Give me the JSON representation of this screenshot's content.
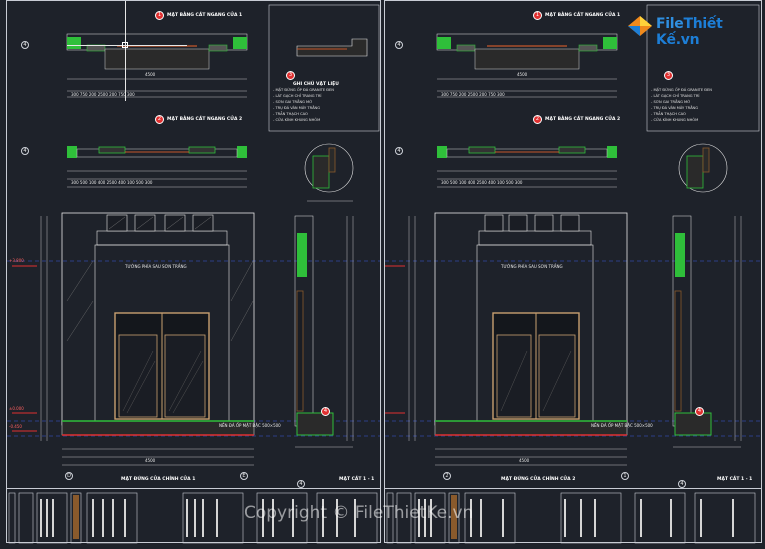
{
  "sheets": [
    {
      "plan_top_title": "MẶT BẰNG CẮT NGANG CỬA 1",
      "plan_mid_title": "MẶT BẰNG CẮT NGANG CỬA 2",
      "plan_top_badge": "1",
      "plan_mid_badge": "2",
      "detail_badge": "3",
      "section_badge": "4",
      "axis_top": "4",
      "axis_mid": "4",
      "axis_bottom_left": "D",
      "axis_bottom_right": "E",
      "axis_section": "4",
      "elevation_title": "MẶT ĐỨNG CỬA CHÍNH CỬA 1",
      "section_title": "MẶT CẮT 1 - 1",
      "notes_title": "GHI CHÚ VẬT LIỆU",
      "width_dim": "4500",
      "door_label": "TƯỜNG PHÍA SAU SƠN TRẮNG",
      "floor_label": "NỀN ĐÁ ỐP MẶT BẬC 500×500",
      "top_plan_dims": "300  750  200    2500    200  750  300",
      "mid_plan_dims": "300  500  100  400    2500    400  100  500  300",
      "level_top": "+3.800",
      "level_base": "±0.000",
      "level_ground": "-0.450"
    },
    {
      "plan_top_title": "MẶT BẰNG CẮT NGANG CỬA 1",
      "plan_mid_title": "MẶT BẰNG CẮT NGANG CỬA 2",
      "plan_top_badge": "1",
      "plan_mid_badge": "2",
      "detail_badge": "3",
      "section_badge": "4",
      "axis_top": "4",
      "axis_mid": "4",
      "axis_bottom_left": "2",
      "axis_bottom_right": "1",
      "axis_section": "4",
      "elevation_title": "MẶT ĐỨNG CỬA CHÍNH CỬA 2",
      "section_title": "MẶT CẮT 1 - 1",
      "notes_title": "GHI CHÚ VẬT LIỆU",
      "width_dim": "4500",
      "door_label": "TƯỜNG PHÍA SAU SƠN TRẮNG",
      "floor_label": "NỀN ĐÁ ỐP MẶT BẬC 500×500",
      "top_plan_dims": "300  750  200    2500    200  750  300",
      "mid_plan_dims": "300  500  100  400    2500    400  100  500  300",
      "level_top": "+3.800",
      "level_base": "±0.000",
      "level_ground": "-0.450"
    }
  ],
  "notes": [
    "MẶT ĐỨNG ỐP ĐÁ GRANITE ĐEN",
    "LÁT GẠCH CHỈ TRANG TRÍ",
    "SƠN GAI TRẮNG MỜ",
    "TRỤ ĐÁ VÂN MÂY TRẮNG",
    "TRẦN THẠCH CAO",
    "CỬA KÍNH KHUNG NHÔM"
  ],
  "watermark": {
    "logo_text_a": "File",
    "logo_text_b": "Thiết Kế",
    "logo_text_c": ".vn",
    "copyright": "Copyright © FileThietKe.vn"
  },
  "colors": {
    "background": "#1e222a",
    "wall_green": "#2fbf3a",
    "accent_red": "#e03030",
    "line_white": "#e6e6e6",
    "dash_blue": "#3a58e0",
    "wood_brown": "#8a5a2c",
    "brand_blue": "#1d7ed6"
  }
}
